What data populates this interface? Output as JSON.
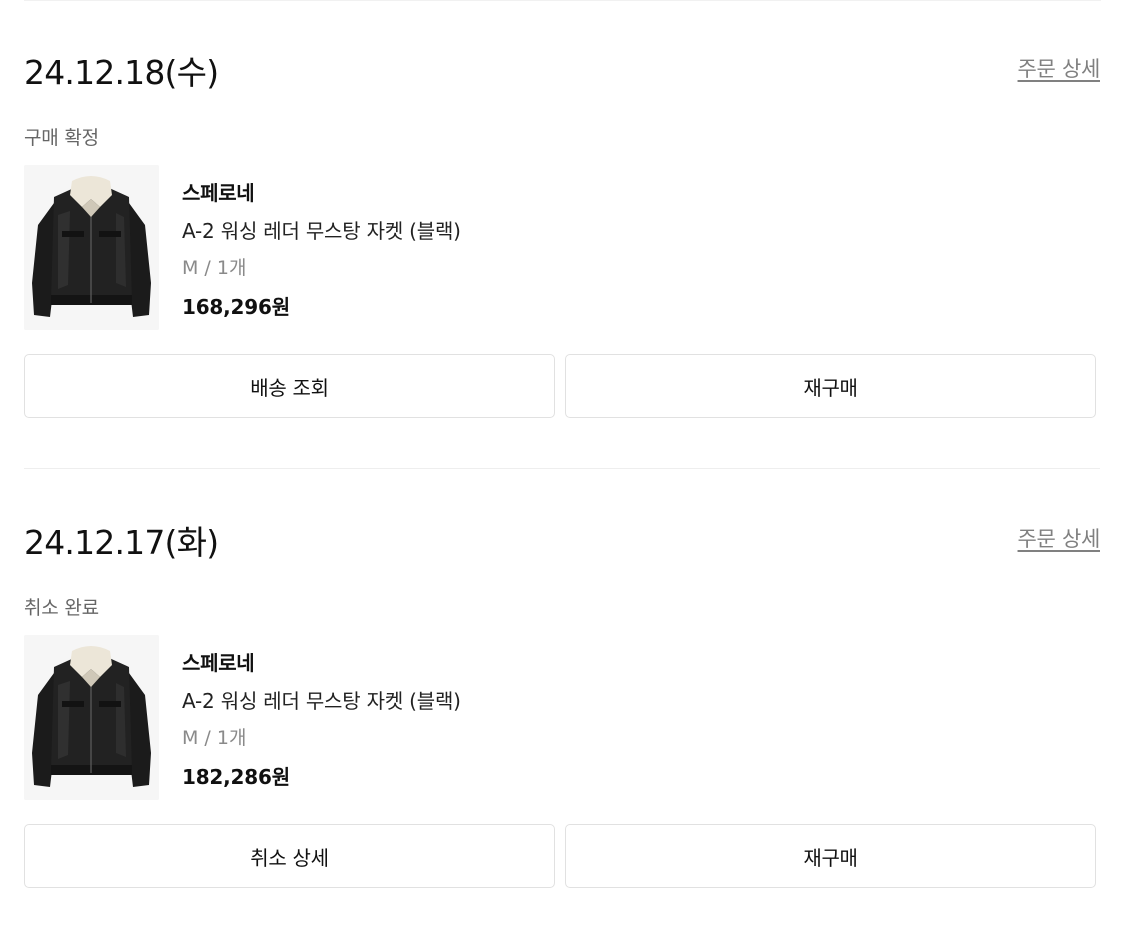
{
  "orders": [
    {
      "date": "24.12.18(수)",
      "detail_link": "주문 상세",
      "status": "구매 확정",
      "item": {
        "image": "black-leather-jacket-thumbnail",
        "brand": "스페로네",
        "name": "A-2 워싱 레더 무스탕 자켓 (블랙)",
        "option": "M / 1개",
        "price": "168,296원"
      },
      "buttons": {
        "primary": "배송 조회",
        "secondary": "재구매"
      }
    },
    {
      "date": "24.12.17(화)",
      "detail_link": "주문 상세",
      "status": "취소 완료",
      "item": {
        "image": "black-leather-jacket-thumbnail",
        "brand": "스페로네",
        "name": "A-2 워싱 레더 무스탕 자켓 (블랙)",
        "option": "M / 1개",
        "price": "182,286원"
      },
      "buttons": {
        "primary": "취소 상세",
        "secondary": "재구매"
      }
    }
  ],
  "colors": {
    "text": "#111111",
    "muted": "#808080",
    "border": "#e1e1e1",
    "jacket": "#1b1b1b",
    "collar": "#ece6d8"
  }
}
